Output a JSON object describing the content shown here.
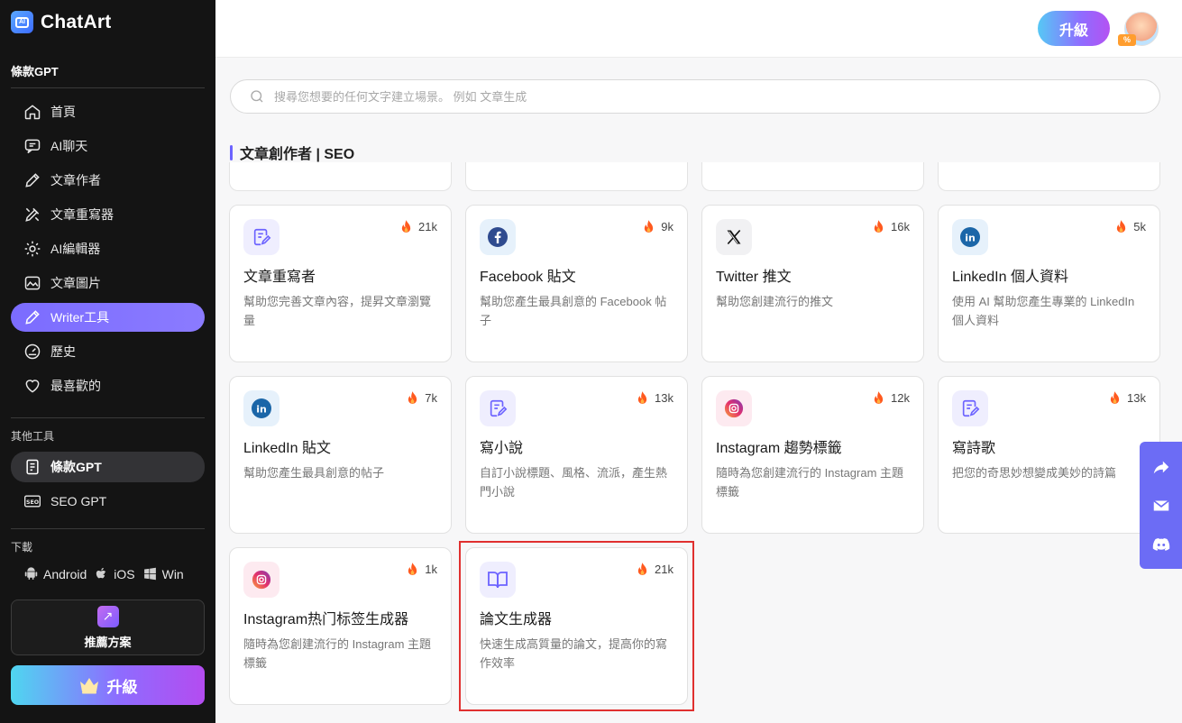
{
  "app": {
    "name": "ChatArt"
  },
  "sidebar": {
    "section1_title": "條款GPT",
    "items": [
      {
        "label": "首頁",
        "icon": "home-icon"
      },
      {
        "label": "AI聊天",
        "icon": "chat-icon"
      },
      {
        "label": "文章作者",
        "icon": "pencil-icon"
      },
      {
        "label": "文章重寫器",
        "icon": "rewrite-icon"
      },
      {
        "label": "AI編輯器",
        "icon": "gear-icon"
      },
      {
        "label": "文章圖片",
        "icon": "image-icon"
      },
      {
        "label": "Writer工具",
        "icon": "pencil-icon"
      },
      {
        "label": "歷史",
        "icon": "gauge-icon"
      },
      {
        "label": "最喜歡的",
        "icon": "heart-icon"
      }
    ],
    "section2_title": "其他工具",
    "tools": [
      {
        "label": "條款GPT",
        "icon": "document-icon"
      },
      {
        "label": "SEO GPT",
        "icon": "seo-icon"
      }
    ],
    "download_title": "下載",
    "downloads": {
      "android": "Android",
      "ios": "iOS",
      "win": "Win"
    },
    "referral_label": "推薦方案",
    "upgrade_label": "升級"
  },
  "header": {
    "upgrade_label": "升級",
    "avatar_badge": "%"
  },
  "search": {
    "placeholder": "搜尋您想要的任何文字建立場景。 例如 文章生成"
  },
  "category": {
    "title": "文章創作者 | SEO"
  },
  "cards": [
    {
      "title": "文章重寫者",
      "count": "21k",
      "desc": "幫助您完善文章內容，提昇文章瀏覽量",
      "icon": "rewrite-icon"
    },
    {
      "title": "Facebook 貼文",
      "count": "9k",
      "desc": "幫助您產生最具創意的 Facebook 帖子",
      "icon": "facebook-icon"
    },
    {
      "title": "Twitter 推文",
      "count": "16k",
      "desc": "幫助您創建流行的推文",
      "icon": "x-icon"
    },
    {
      "title": "LinkedIn 個人資料",
      "count": "5k",
      "desc": "使用 AI 幫助您產生專業的 LinkedIn 個人資料",
      "icon": "linkedin-icon"
    },
    {
      "title": "LinkedIn 貼文",
      "count": "7k",
      "desc": "幫助您產生最具創意的帖子",
      "icon": "linkedin-icon"
    },
    {
      "title": "寫小說",
      "count": "13k",
      "desc": "自訂小說標題、風格、流派，產生熱門小說",
      "icon": "rewrite-icon"
    },
    {
      "title": "Instagram 趨勢標籤",
      "count": "12k",
      "desc": "隨時為您創建流行的 Instagram 主題標籤",
      "icon": "instagram-icon"
    },
    {
      "title": "寫詩歌",
      "count": "13k",
      "desc": "把您的奇思妙想變成美妙的詩篇",
      "icon": "rewrite-icon"
    },
    {
      "title": "Instagram热门标签生成器",
      "count": "1k",
      "desc": "隨時為您創建流行的 Instagram 主題標籤",
      "icon": "instagram-icon"
    },
    {
      "title": "論文生成器",
      "count": "21k",
      "desc": "快速生成高質量的論文，提高你的寫作效率",
      "icon": "book-icon"
    }
  ],
  "colors": {
    "accent": "#6c63ff",
    "sidebar_bg": "#141414",
    "highlight": "#e0302f",
    "fire": "#ff5a1f"
  }
}
